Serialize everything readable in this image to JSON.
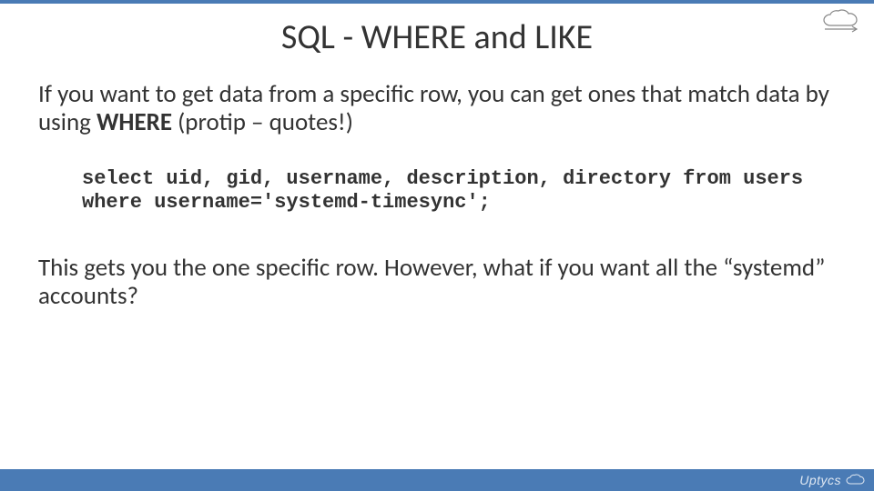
{
  "slide": {
    "title": "SQL - WHERE and LIKE",
    "intro_prefix": "If you want to get data from a specific row, you can get ones that match data by using ",
    "intro_bold": "WHERE",
    "intro_suffix": " (protip – quotes!)",
    "code": "select uid, gid, username, description, directory from users where username='systemd-timesync';",
    "outro": "This gets you the one specific row. However, what if you want all the “systemd” accounts?"
  },
  "footer": {
    "brand": "Uptycs"
  },
  "icons": {
    "cloud_top": "cloud-arrow-icon",
    "cloud_footer": "cloud-icon"
  }
}
